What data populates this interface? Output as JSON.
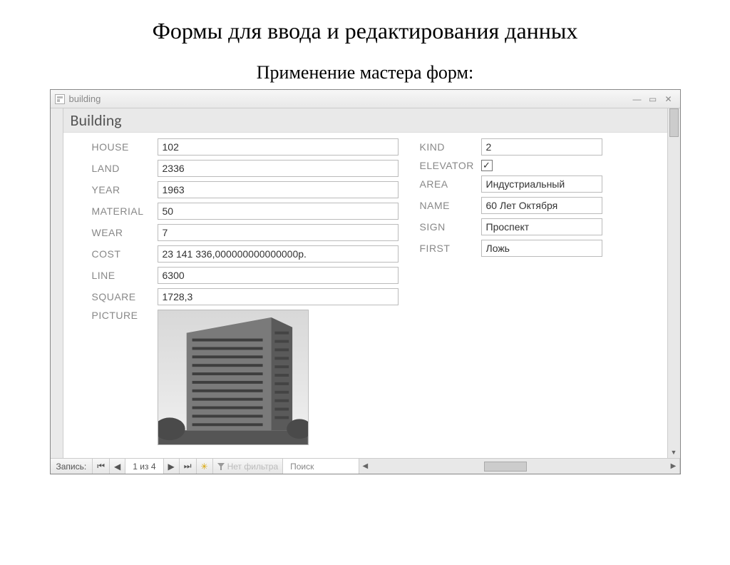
{
  "page": {
    "title": "Формы для ввода и редактирования данных",
    "subtitle": "Применение мастера форм:"
  },
  "window": {
    "title": "building",
    "form_header": "Building"
  },
  "left_fields": {
    "house": {
      "label": "HOUSE",
      "value": "102"
    },
    "land": {
      "label": "LAND",
      "value": "2336"
    },
    "year": {
      "label": "YEAR",
      "value": "1963"
    },
    "material": {
      "label": "MATERIAL",
      "value": "50"
    },
    "wear": {
      "label": "WEAR",
      "value": "7"
    },
    "cost": {
      "label": "COST",
      "value": "23 141 336,000000000000000р."
    },
    "line": {
      "label": "LINE",
      "value": "6300"
    },
    "square": {
      "label": "SQUARE",
      "value": "1728,3"
    },
    "picture": {
      "label": "PICTURE"
    }
  },
  "right_fields": {
    "kind": {
      "label": "KIND",
      "value": "2"
    },
    "elevator": {
      "label": "ELEVATOR",
      "checked": true
    },
    "area": {
      "label": "AREA",
      "value": "Индустриальный"
    },
    "name": {
      "label": "NAME",
      "value": "60 Лет Октября"
    },
    "sign": {
      "label": "SIGN",
      "value": "Проспект"
    },
    "first": {
      "label": "FIRST",
      "value": "Ложь"
    }
  },
  "nav": {
    "record_label": "Запись:",
    "counter": "1 из 4",
    "filter_text": "Нет фильтра",
    "search_label": "Поиск"
  }
}
